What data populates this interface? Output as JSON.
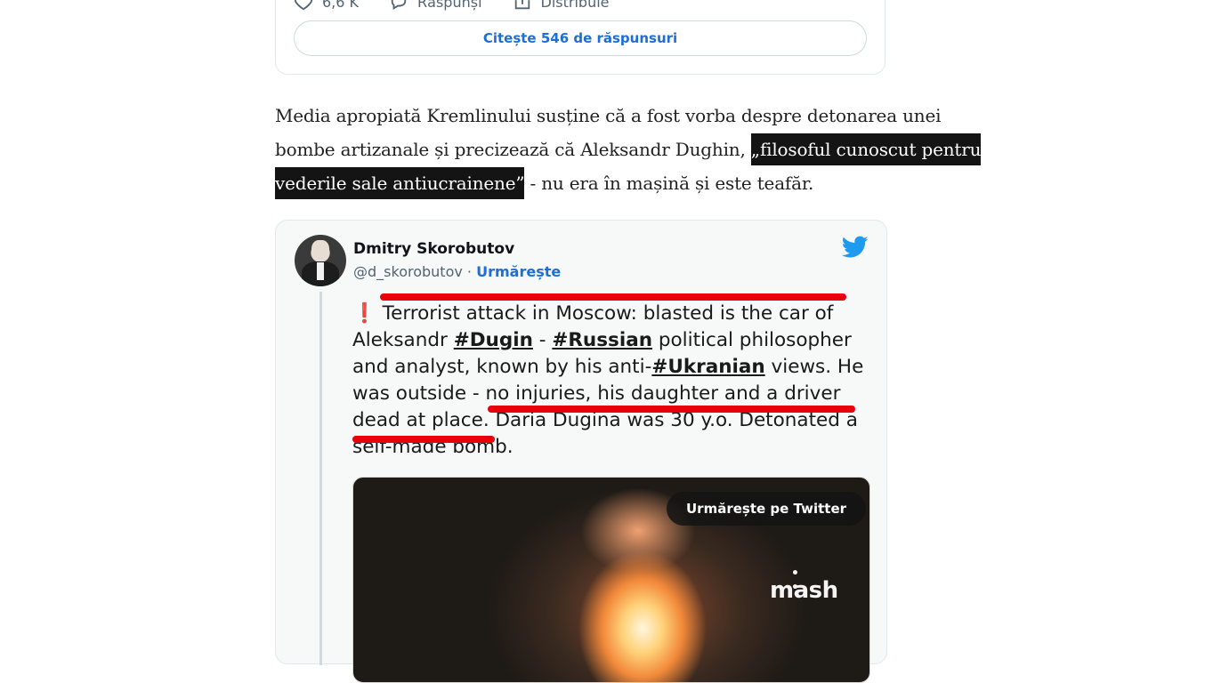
{
  "top_card": {
    "like_count": "6,6 K",
    "reply_label": "Răspunși",
    "share_label": "Distribuie",
    "read_replies": "Citește 546 de răspunsuri"
  },
  "article": {
    "para_text_1": "Media apropiată Kremlinului susține că a fost vorba despre detonarea unei bombe artizanale și precizează că Aleksandr Dughin, ",
    "highlight": "„filosoful cunoscut pentru vederile sale antiucrainene”",
    "para_text_2": " - nu era în mașină și este teafăr."
  },
  "tweet": {
    "author_name": "Dmitry Skorobutov",
    "handle": "@d_skorobutov",
    "separator": " · ",
    "follow_label": "Urmărește",
    "text": {
      "excl": "❗",
      "t1": " Terrorist attack in Moscow: blasted is the car of Aleksandr ",
      "tag1": "#Dugin",
      "t2": " - ",
      "tag2": "#Russian",
      "t3": " political philosopher and analyst, known by his anti-",
      "tag3": "#Ukranian",
      "t4": " views. He was outside - no injuries, his daughter and a driver dead at place. Daria Dugina was 30 y.o. Detonated a self-made bomb."
    },
    "media": {
      "follow_on_twitter": "Urmărește pe Twitter",
      "watermark": "mash",
      "watermark_dots": "• •"
    }
  },
  "colors": {
    "link_blue": "#1d6fd6",
    "twitter_blue": "#1d9bf0",
    "highlight_bg": "#141414",
    "annotation_red": "#e8000b"
  },
  "icons": [
    "heart-icon",
    "reply-icon",
    "share-icon",
    "twitter-bird-icon"
  ]
}
